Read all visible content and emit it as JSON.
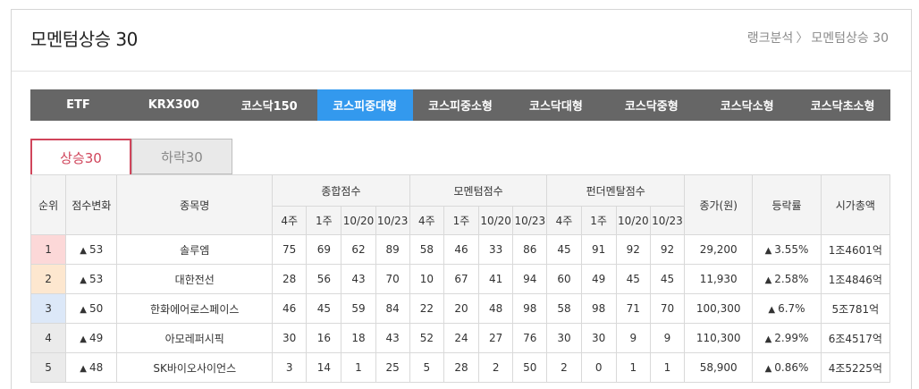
{
  "page": {
    "title": "모멘텀상승 30",
    "breadcrumb": {
      "parent": "랭크분석",
      "separator": "〉",
      "current": "모멘텀상승 30"
    }
  },
  "market_tabs": [
    "ETF",
    "KRX300",
    "코스닥150",
    "코스피중대형",
    "코스피중소형",
    "코스닥대형",
    "코스닥중형",
    "코스닥소형",
    "코스닥초소형"
  ],
  "active_market_tab": "코스피중대형",
  "sub_tabs": {
    "up": "상승30",
    "down": "하락30",
    "active": "상승30"
  },
  "table": {
    "headers": {
      "rank": "순위",
      "score_change": "점수변화",
      "name": "종목명",
      "total_score": "종합점수",
      "momentum_score": "모멘텀점수",
      "fundamental_score": "펀더멘탈점수",
      "close": "종가(원)",
      "change_rate": "등락률",
      "market_cap": "시가총액"
    },
    "sub_headers": [
      "4주",
      "1주",
      "10/20",
      "10/23"
    ],
    "rows": [
      {
        "rank": "1",
        "delta": "53",
        "name": "솔루엠",
        "total": [
          "75",
          "69",
          "62",
          "89"
        ],
        "momentum": [
          "58",
          "46",
          "33",
          "86"
        ],
        "fundamental": [
          "45",
          "91",
          "92",
          "92"
        ],
        "close": "29,200",
        "change": "3.55%",
        "cap": "1조4601억"
      },
      {
        "rank": "2",
        "delta": "53",
        "name": "대한전선",
        "total": [
          "28",
          "56",
          "43",
          "70"
        ],
        "momentum": [
          "10",
          "67",
          "41",
          "94"
        ],
        "fundamental": [
          "60",
          "49",
          "45",
          "45"
        ],
        "close": "11,930",
        "change": "2.58%",
        "cap": "1조4846억"
      },
      {
        "rank": "3",
        "delta": "50",
        "name": "한화에어로스페이스",
        "total": [
          "46",
          "45",
          "59",
          "84"
        ],
        "momentum": [
          "22",
          "20",
          "48",
          "98"
        ],
        "fundamental": [
          "58",
          "98",
          "71",
          "70"
        ],
        "close": "100,300",
        "change": "6.7%",
        "cap": "5조781억"
      },
      {
        "rank": "4",
        "delta": "49",
        "name": "아모레퍼시픽",
        "total": [
          "30",
          "16",
          "18",
          "43"
        ],
        "momentum": [
          "52",
          "24",
          "27",
          "76"
        ],
        "fundamental": [
          "30",
          "30",
          "9",
          "9"
        ],
        "close": "110,300",
        "change": "2.99%",
        "cap": "6조4517억"
      },
      {
        "rank": "5",
        "delta": "48",
        "name": "SK바이오사이언스",
        "total": [
          "3",
          "14",
          "1",
          "25"
        ],
        "momentum": [
          "5",
          "28",
          "2",
          "50"
        ],
        "fundamental": [
          "2",
          "0",
          "1",
          "1"
        ],
        "close": "58,900",
        "change": "0.86%",
        "cap": "4조5225억"
      }
    ]
  },
  "colors": {
    "tab_bar": "#666666",
    "active_tab": "#3399ee",
    "up": "#e03a3a",
    "active_subtab": "#d0455b"
  },
  "icons": {
    "up_arrow": "triangle-up-icon",
    "breadcrumb_sep": "chevron-right-icon"
  }
}
